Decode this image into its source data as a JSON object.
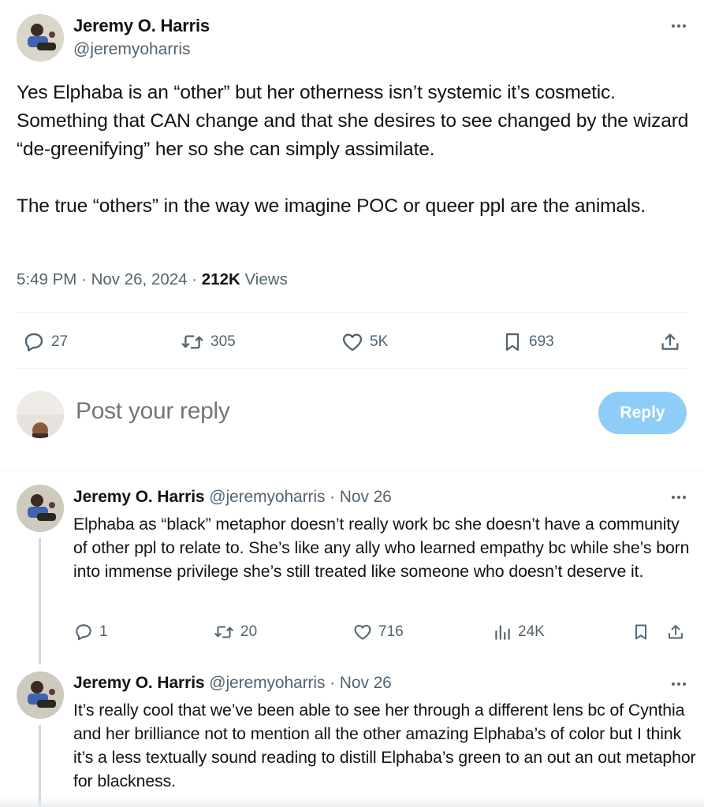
{
  "main_tweet": {
    "author_name": "Jeremy O. Harris",
    "author_handle": "@jeremyoharris",
    "text_p1": "Yes Elphaba is an “other” but her otherness isn’t systemic it’s cosmetic. Something that CAN change and that she desires to see changed by the wizard “de-greenifying” her so she can simply assimilate.",
    "text_p2": "The true “others” in the way we imagine POC or queer ppl are the animals.",
    "time": "5:49 PM",
    "separator": "·",
    "date": "Nov 26, 2024",
    "views_count": "212K",
    "views_label": "Views",
    "stats": {
      "replies": "27",
      "reposts": "305",
      "likes": "5K",
      "bookmarks": "693"
    },
    "icons": [
      "more-icon",
      "reply-icon",
      "repost-icon",
      "like-icon",
      "bookmark-icon",
      "share-icon"
    ]
  },
  "reply_box": {
    "placeholder": "Post your reply",
    "button_label": "Reply",
    "button_color": "#8ecdf8"
  },
  "replies": [
    {
      "author_name": "Jeremy O. Harris",
      "author_handle": "@jeremyoharris",
      "separator": "·",
      "date": "Nov 26",
      "text": "Elphaba as “black” metaphor doesn’t really work bc she doesn’t have a community of other ppl to relate to. She’s like any ally who learned empathy bc while she’s born into immense privilege she’s still treated like someone who doesn’t deserve it.",
      "stats": {
        "replies": "1",
        "reposts": "20",
        "likes": "716",
        "views": "24K"
      }
    },
    {
      "author_name": "Jeremy O. Harris",
      "author_handle": "@jeremyoharris",
      "separator": "·",
      "date": "Nov 26",
      "text": "It’s really cool that we’ve been able to see her through a different lens bc of Cynthia and her brilliance not to mention all the other amazing Elphaba’s of color but I think it’s a less textually sound reading to distill Elphaba’s green to an out an out metaphor for blackness."
    }
  ],
  "colors": {
    "text_primary": "#0f1419",
    "text_secondary": "#536471",
    "divider": "#eff3f4",
    "thread_line": "#cfd9de"
  }
}
